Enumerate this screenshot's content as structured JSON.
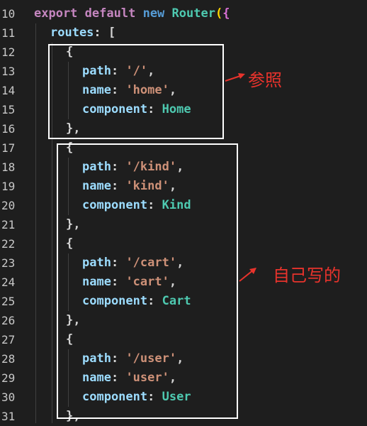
{
  "line_numbers": [
    "10",
    "11",
    "12",
    "13",
    "14",
    "15",
    "16",
    "17",
    "18",
    "19",
    "20",
    "21",
    "22",
    "23",
    "24",
    "25",
    "26",
    "27",
    "28",
    "29",
    "30",
    "31"
  ],
  "code": {
    "l10": {
      "k1": "export",
      "k2": "default",
      "k3": "new",
      "cls": "Router",
      "p1": "(",
      "p2": "{"
    },
    "l11": {
      "prop": "routes",
      "colon": ":",
      "br": "["
    },
    "home": {
      "open": "{",
      "path_key": "path",
      "path_val": "'/'",
      "name_key": "name",
      "name_val": "'home'",
      "comp_key": "component",
      "comp_val": "Home",
      "close": "},"
    },
    "kind": {
      "open": "{",
      "path_key": "path",
      "path_val": "'/kind'",
      "name_key": "name",
      "name_val": "'kind'",
      "comp_key": "component",
      "comp_val": "Kind",
      "close": "},"
    },
    "cart": {
      "open": "{",
      "path_key": "path",
      "path_val": "'/cart'",
      "name_key": "name",
      "name_val": "'cart'",
      "comp_key": "component",
      "comp_val": "Cart",
      "close": "},"
    },
    "user": {
      "open": "{",
      "path_key": "path",
      "path_val": "'/user'",
      "name_key": "name",
      "name_val": "'user'",
      "comp_key": "component",
      "comp_val": "User",
      "close": "},"
    }
  },
  "annotations": {
    "reference_label": "参照",
    "self_written_label": "自己写的",
    "annotation_color": "#e8332c",
    "box_color": "#ffffff"
  },
  "colors": {
    "background": "#1e1e1e",
    "keyword_purple": "#c586c0",
    "keyword_blue": "#569cd6",
    "class_name": "#4ec9b0",
    "property": "#9cdcfe",
    "string": "#ce9178"
  }
}
